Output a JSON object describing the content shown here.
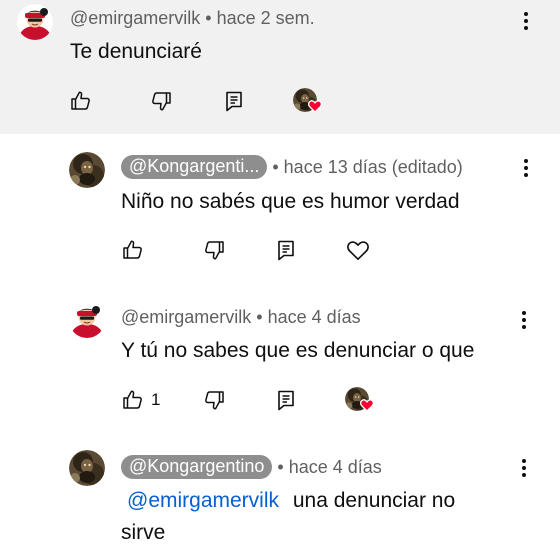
{
  "comments": [
    {
      "handle": "@emirgamervilk",
      "time": "hace 2 sem.",
      "text": "Te denunciaré",
      "likes": "",
      "heart_icon": "creator-heart-icon"
    },
    {
      "handle": "@Kongargenti...",
      "time": "hace 13 días (editado)",
      "text": "Niño no  sabés que es humor verdad",
      "likes": "",
      "heart_icon": "heart-outline-icon"
    },
    {
      "handle": "@emirgamervilk",
      "time": "hace 4 días",
      "text": "Y tú no sabes que es denunciar o que",
      "likes": "1",
      "heart_icon": "creator-heart-icon"
    },
    {
      "handle": "@Kongargentino",
      "time": "hace 4 días",
      "mention": "@emirgamervilk",
      "text_line1": "una denunciar no",
      "text_line2": "sirve",
      "likes": ""
    }
  ],
  "separator": "•",
  "colors": {
    "highlight_bg": "#f1f1f1",
    "secondary_text": "#606060",
    "chip_bg": "#8e8e8e",
    "mention": "#065fd4",
    "heart": "#ff0033"
  }
}
